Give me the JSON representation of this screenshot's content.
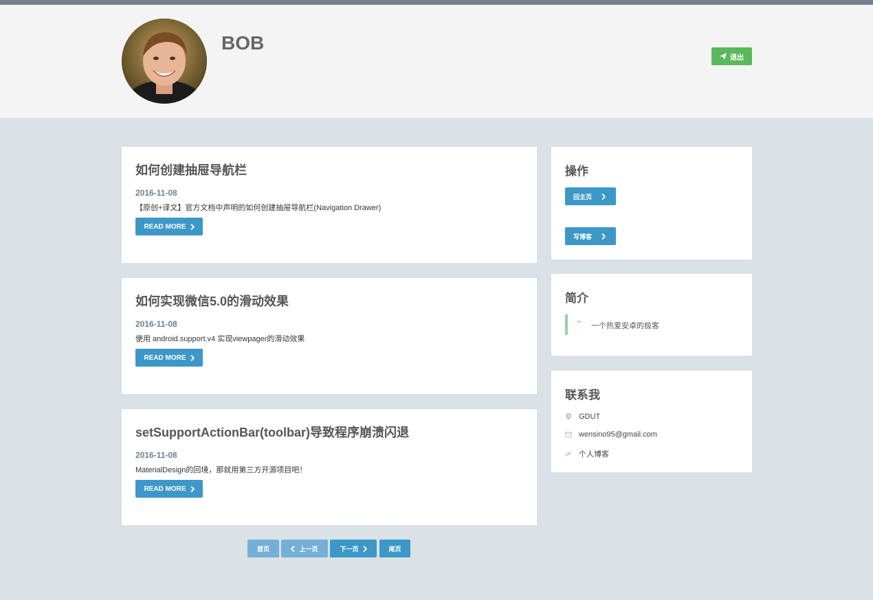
{
  "header": {
    "username": "BOB",
    "logout_label": "退出"
  },
  "posts": [
    {
      "title": "如何创建抽屉导航栏",
      "date": "2016-11-08",
      "summary": "【原创+译文】官方文档中声明的如何创建抽屉导航栏(Navigation Drawer)",
      "read_more": "READ MORE"
    },
    {
      "title": "如何实现微信5.0的滑动效果",
      "date": "2016-11-08",
      "summary": "使用 android.support.v4 实现viewpager的滑动效果",
      "read_more": "READ MORE"
    },
    {
      "title": "setSupportActionBar(toolbar)导致程序崩溃闪退",
      "date": "2016-11-08",
      "summary": "MaterialDesign的回境，那就用第三方开源项目吧！",
      "read_more": "READ MORE"
    }
  ],
  "sidebar": {
    "operations": {
      "title": "操作",
      "home_label": "回主页",
      "write_label": "写博客"
    },
    "intro": {
      "title": "简介",
      "quote_icon": "“",
      "text": "一个热爱安卓的极客"
    },
    "contact": {
      "title": "联系我",
      "items": [
        {
          "icon": "map-marker-icon",
          "text": "GDUT"
        },
        {
          "icon": "envelope-icon",
          "text": "wensino95@gmail.com"
        },
        {
          "icon": "link-icon",
          "text": "个人博客"
        }
      ]
    }
  },
  "pagination": {
    "first": "首页",
    "prev": "上一页",
    "next": "下一页",
    "last": "尾页"
  },
  "colors": {
    "primary": "#3d98c8",
    "success": "#5cb85c",
    "background": "#dae1e7",
    "header_bg": "#f4f4f4",
    "quote_accent": "#94d3a8"
  }
}
